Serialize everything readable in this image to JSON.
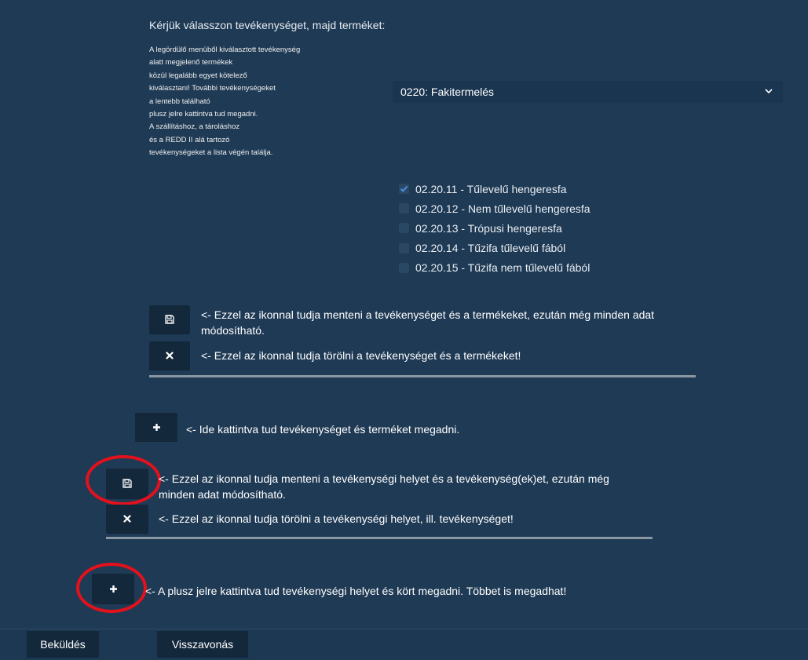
{
  "heading": "Kérjük válasszon tevékenységet, majd terméket:",
  "note_lines": [
    "A legördülő menüből kiválasztott tevékenység",
    "alatt megjelenő termékek",
    "közül legalább egyet kötelező",
    "kiválasztani! További tevékenységeket",
    "a lentebb található",
    "plusz jelre kattintva tud megadni.",
    "A szállításhoz, a tároláshoz",
    "és a REDD II alá tartozó",
    "tevékenységeket a lista végén találja."
  ],
  "activity_select": {
    "value": "0220: Fakitermelés",
    "icon": "chevron-down-icon"
  },
  "products": [
    {
      "label": "02.20.11 - Tűlevelű hengeresfa",
      "checked": true
    },
    {
      "label": "02.20.12 - Nem tűlevelű hengeresfa",
      "checked": false
    },
    {
      "label": "02.20.13 - Trópusi hengeresfa",
      "checked": false
    },
    {
      "label": "02.20.14 - Tűzifa tűlevelű fából",
      "checked": false
    },
    {
      "label": "02.20.15 - Tűzifa nem tűlevelű fából",
      "checked": false
    }
  ],
  "activity_block": {
    "save_text_1": "<- Ezzel az ikonnal tudja menteni a tevékenységet és a termékeket, ezután még minden adat",
    "save_text_2": "módosítható.",
    "delete_text": "<- Ezzel az ikonnal tudja törölni a tevékenységet és a termékeket!"
  },
  "add_activity_text": "<- Ide kattintva tud tevékenységet és terméket megadni.",
  "location_block": {
    "save_text_1": "<- Ezzel az ikonnal tudja menteni a tevékenységi helyet és a tevékenység(ek)et, ezután még",
    "save_text_2": "minden adat módosítható.",
    "delete_text": "<- Ezzel az ikonnal tudja törölni a tevékenységi helyet, ill. tevékenységet!"
  },
  "add_location_text": "<- A plusz jelre kattintva tud tevékenységi helyet és kört megadni. Többet is megadhat!",
  "footer": {
    "submit_label": "Beküldés",
    "cancel_label": "Visszavonás"
  },
  "colors": {
    "background": "#1f3a55",
    "button": "#14283c",
    "highlight_ring": "#e3111c",
    "checkbox_accent": "#4a90e2"
  },
  "icons": [
    "floppy-disk-icon",
    "close-icon",
    "plus-icon",
    "chevron-down-icon",
    "checkmark-icon"
  ]
}
